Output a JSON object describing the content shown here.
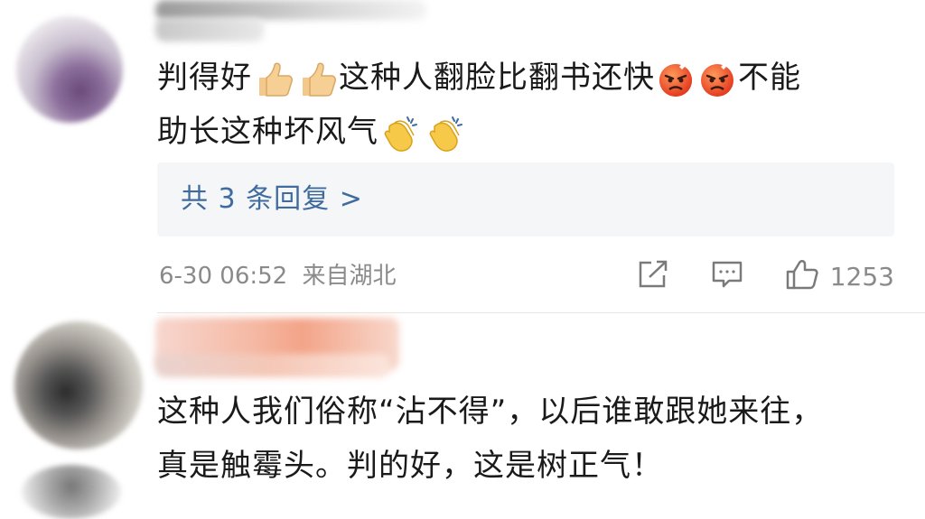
{
  "comments": [
    {
      "text_part1": "判得好",
      "text_part2": "这种人翻脸比翻书还快",
      "text_part3": "不能",
      "text_line2": "助长这种坏风气",
      "emoji": [
        "thumbs-up-emoji",
        "thumbs-up-emoji",
        "angry-face-emoji",
        "angry-face-emoji",
        "clapping-hands-emoji",
        "clapping-hands-emoji"
      ],
      "reply_link": "共 3 条回复 >",
      "timestamp": "6-30 06:52",
      "location": "来自湖北",
      "like_count": "1253"
    },
    {
      "text_line1": "这种人我们俗称“沾不得”，以后谁敢跟她来往，",
      "text_line2": "真是触霉头。判的好，这是树正气！"
    }
  ],
  "icons": {
    "share": "share-icon",
    "comment": "comment-icon",
    "like": "thumbs-up-icon"
  },
  "colors": {
    "link": "#3f6b9e",
    "meta": "#8a8a8a",
    "reply_bg": "#f4f6f8"
  }
}
